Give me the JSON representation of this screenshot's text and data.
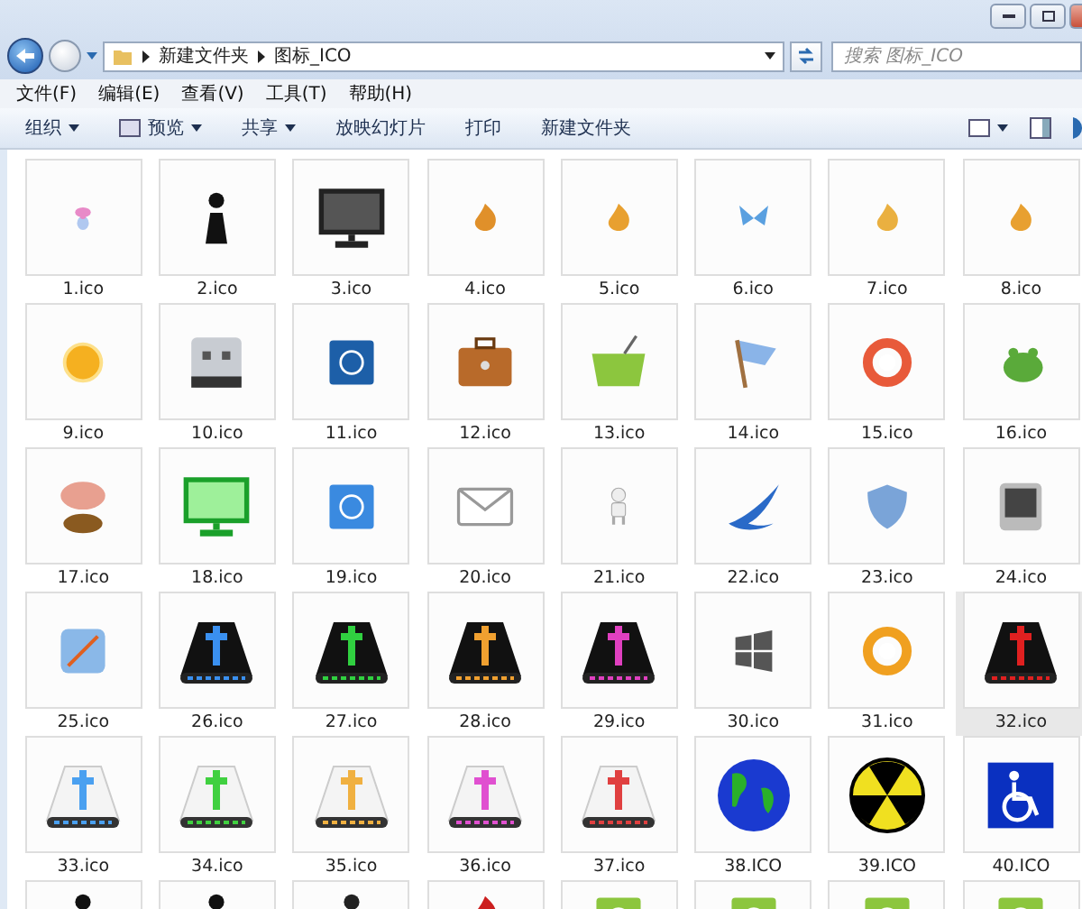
{
  "address": {
    "path": [
      "新建文件夹",
      "图标_ICO"
    ]
  },
  "search": {
    "placeholder": "搜索 图标_ICO"
  },
  "menu": [
    "文件(F)",
    "编辑(E)",
    "查看(V)",
    "工具(T)",
    "帮助(H)"
  ],
  "toolbar": [
    {
      "label": "组织",
      "kind": "dropdown"
    },
    {
      "label": "预览",
      "kind": "preview"
    },
    {
      "label": "共享",
      "kind": "dropdown"
    },
    {
      "label": "放映幻灯片",
      "kind": "plain"
    },
    {
      "label": "打印",
      "kind": "plain"
    },
    {
      "label": "新建文件夹",
      "kind": "plain"
    }
  ],
  "files": [
    {
      "name": "1.ico",
      "kind": "doll",
      "color": "#e88ac8",
      "selected": false
    },
    {
      "name": "2.ico",
      "kind": "figure",
      "color": "#111111",
      "selected": false
    },
    {
      "name": "3.ico",
      "kind": "monitor",
      "color": "#222222",
      "selected": false
    },
    {
      "name": "4.ico",
      "kind": "flame",
      "color": "#e0902a",
      "selected": false
    },
    {
      "name": "5.ico",
      "kind": "flame",
      "color": "#e8a030",
      "selected": false
    },
    {
      "name": "6.ico",
      "kind": "butterfly",
      "color": "#5aa0e0",
      "selected": false
    },
    {
      "name": "7.ico",
      "kind": "flame",
      "color": "#eab040",
      "selected": false
    },
    {
      "name": "8.ico",
      "kind": "flame",
      "color": "#e8a030",
      "selected": false
    },
    {
      "name": "9.ico",
      "kind": "sun",
      "color": "#f5b020",
      "selected": false
    },
    {
      "name": "10.ico",
      "kind": "drive",
      "color": "#c8ccd2",
      "selected": false
    },
    {
      "name": "11.ico",
      "kind": "tile",
      "color": "#1d5fa8",
      "selected": false
    },
    {
      "name": "12.ico",
      "kind": "briefcase",
      "color": "#b86a2a",
      "selected": false
    },
    {
      "name": "13.ico",
      "kind": "basket",
      "color": "#8cc63e",
      "selected": false
    },
    {
      "name": "14.ico",
      "kind": "flag",
      "color": "#8ab4e8",
      "selected": false
    },
    {
      "name": "15.ico",
      "kind": "ring",
      "color": "#e85a3a",
      "selected": false
    },
    {
      "name": "16.ico",
      "kind": "frog",
      "color": "#5aaa3a",
      "selected": false
    },
    {
      "name": "17.ico",
      "kind": "mushroom",
      "color": "#e8a090",
      "selected": false
    },
    {
      "name": "18.ico",
      "kind": "monitor",
      "color": "#1aa02a",
      "selected": false
    },
    {
      "name": "19.ico",
      "kind": "tile",
      "color": "#3a8ae0",
      "selected": false
    },
    {
      "name": "20.ico",
      "kind": "envelope",
      "color": "#999999",
      "selected": false
    },
    {
      "name": "21.ico",
      "kind": "robot",
      "color": "#aaaaaa",
      "selected": false
    },
    {
      "name": "22.ico",
      "kind": "wing",
      "color": "#2a6ac8",
      "selected": false
    },
    {
      "name": "23.ico",
      "kind": "shield",
      "color": "#7aa4d8",
      "selected": false
    },
    {
      "name": "24.ico",
      "kind": "tablet",
      "color": "#444444",
      "selected": false
    },
    {
      "name": "25.ico",
      "kind": "compass",
      "color": "#8ab8e8",
      "selected": false
    },
    {
      "name": "26.ico",
      "kind": "dark-drive",
      "color": "#3a90f0",
      "selected": false
    },
    {
      "name": "27.ico",
      "kind": "dark-drive",
      "color": "#30d040",
      "selected": false
    },
    {
      "name": "28.ico",
      "kind": "dark-drive",
      "color": "#f0a030",
      "selected": false
    },
    {
      "name": "29.ico",
      "kind": "dark-drive",
      "color": "#e040c0",
      "selected": false
    },
    {
      "name": "30.ico",
      "kind": "windows",
      "color": "#555555",
      "selected": false
    },
    {
      "name": "31.ico",
      "kind": "ring",
      "color": "#f0a020",
      "selected": false
    },
    {
      "name": "32.ico",
      "kind": "dark-drive",
      "color": "#e02020",
      "selected": true
    },
    {
      "name": "33.ico",
      "kind": "light-drive",
      "color": "#4aa0f0",
      "selected": false
    },
    {
      "name": "34.ico",
      "kind": "light-drive",
      "color": "#40d040",
      "selected": false
    },
    {
      "name": "35.ico",
      "kind": "light-drive",
      "color": "#f0b040",
      "selected": false
    },
    {
      "name": "36.ico",
      "kind": "light-drive",
      "color": "#e050d0",
      "selected": false
    },
    {
      "name": "37.ico",
      "kind": "light-drive",
      "color": "#e04040",
      "selected": false
    },
    {
      "name": "38.ICO",
      "kind": "globe",
      "color": "#1a3ad0",
      "selected": false
    },
    {
      "name": "39.ICO",
      "kind": "radiation",
      "color": "#f0e020",
      "selected": false
    },
    {
      "name": "40.ICO",
      "kind": "wheelchair",
      "color": "#0a30c0",
      "selected": false
    },
    {
      "kind": "figure",
      "color": "#111111",
      "selected": false
    },
    {
      "kind": "figure",
      "color": "#111111",
      "selected": false
    },
    {
      "kind": "figure",
      "color": "#222222",
      "selected": false
    },
    {
      "kind": "flame",
      "color": "#cc2020",
      "selected": false
    },
    {
      "kind": "tile",
      "color": "#8cc63e",
      "selected": false
    },
    {
      "kind": "tile",
      "color": "#8cc63e",
      "selected": false
    },
    {
      "kind": "tile",
      "color": "#8cc63e",
      "selected": false
    },
    {
      "kind": "tile",
      "color": "#8cc63e",
      "selected": false
    }
  ]
}
